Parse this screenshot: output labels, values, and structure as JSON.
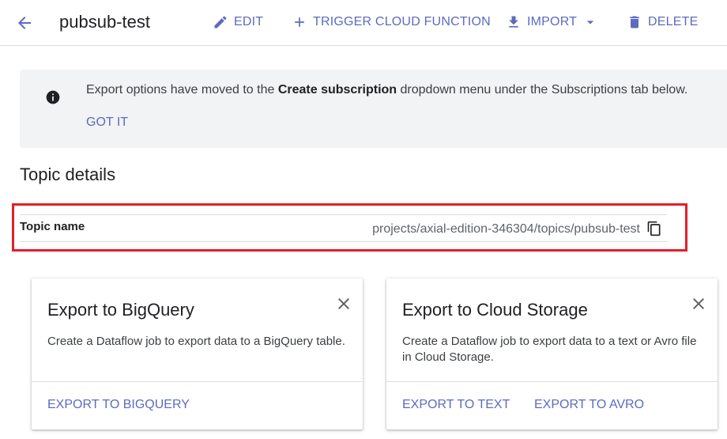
{
  "header": {
    "title": "pubsub-test",
    "edit_label": "EDIT",
    "trigger_label": "TRIGGER CLOUD FUNCTION",
    "import_label": "IMPORT",
    "delete_label": "DELETE"
  },
  "banner": {
    "message_prefix": "Export options have moved to the ",
    "message_bold": "Create subscription",
    "message_suffix": " dropdown menu under the Subscriptions tab below.",
    "action_label": "GOT IT"
  },
  "details": {
    "title": "Topic details",
    "rows": [
      {
        "key": "Topic name",
        "value": "projects/axial-edition-346304/topics/pubsub-test"
      }
    ]
  },
  "cards": [
    {
      "title": "Export to BigQuery",
      "description": "Create a Dataflow job to export data to a BigQuery table.",
      "actions": [
        "EXPORT TO BIGQUERY"
      ]
    },
    {
      "title": "Export to Cloud Storage",
      "description": "Create a Dataflow job to export data to a text or Avro file in Cloud Storage.",
      "actions": [
        "EXPORT TO TEXT",
        "EXPORT TO AVRO"
      ]
    }
  ],
  "colors": {
    "accent": "#5c6bc0",
    "highlight": "#e0202a",
    "banner_bg": "#f1f3f4"
  },
  "icons": [
    "arrow-back-icon",
    "pencil-icon",
    "plus-icon",
    "download-icon",
    "caret-down-icon",
    "trash-icon",
    "info-icon",
    "copy-icon",
    "close-icon"
  ]
}
